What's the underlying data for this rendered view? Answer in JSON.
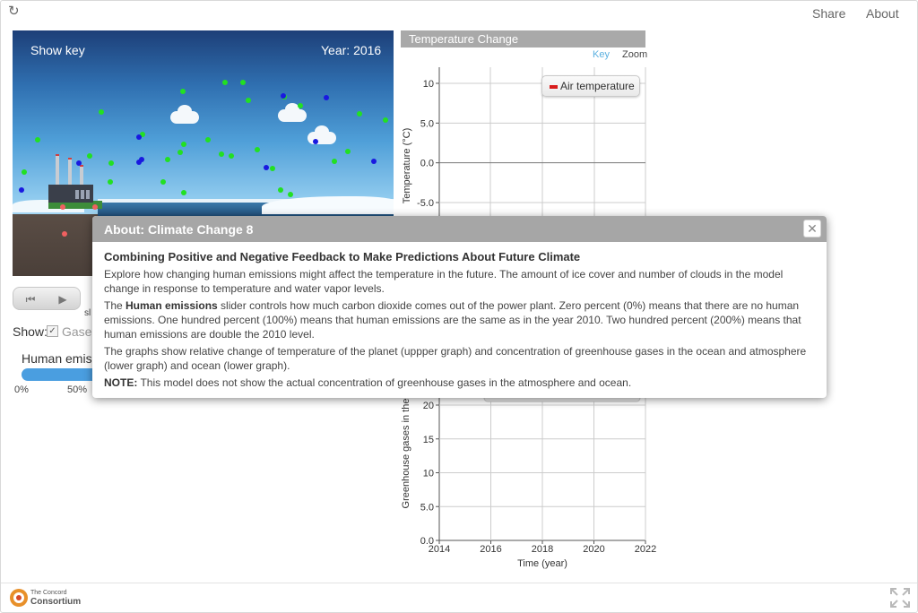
{
  "topbar": {
    "reload_icon": "reload-icon",
    "share": "Share",
    "about": "About"
  },
  "model": {
    "show_key": "Show key",
    "year": "Year: 2016"
  },
  "controls": {
    "slow_label": "sl",
    "show_label": "Show:",
    "gases_label": "Gases",
    "gases_checked": true,
    "emissions_label": "Human emiss",
    "slider_ticks": [
      "0%",
      "50%"
    ],
    "accent": "#4a9ee0"
  },
  "upper_graph": {
    "title": "Temperature Change",
    "key_link": "Key",
    "zoom_link": "Zoom",
    "legend": "Air temperature"
  },
  "lower_graph": {
    "xlabel": "Time (year)",
    "ylabel": "Greenhouse gases in the"
  },
  "chart_data": [
    {
      "type": "line",
      "title": "Temperature Change",
      "ylabel": "Temperature (°C)",
      "y_ticks": [
        "10",
        "5.0",
        "0.0",
        "-5.0"
      ],
      "y_tick_values": [
        10,
        5,
        0,
        -5
      ],
      "ylim": [
        -5,
        10
      ],
      "series": [
        {
          "name": "Air temperature",
          "color": "#d81b1b",
          "values": []
        }
      ],
      "grid": true,
      "legend": "top-right"
    },
    {
      "type": "line",
      "xlabel": "Time (year)",
      "ylabel": "Greenhouse gases in the",
      "x_ticks": [
        "2014",
        "2016",
        "2018",
        "2020",
        "2022"
      ],
      "x_tick_values": [
        2014,
        2016,
        2018,
        2020,
        2022
      ],
      "xlim": [
        2014,
        2022
      ],
      "y_ticks": [
        "20",
        "15",
        "10",
        "5.0",
        "0.0"
      ],
      "y_tick_values": [
        20,
        15,
        10,
        5,
        0
      ],
      "ylim": [
        0,
        20
      ],
      "grid": true
    }
  ],
  "dialog": {
    "title": "About: Climate Change 8",
    "close_icon": "close-icon",
    "heading": "Combining Positive and Negative Feedback to Make Predictions About Future Climate",
    "p1": "Explore how changing human emissions might affect the temperature in the future. The amount of ice cover and number of clouds in the model change in response to temperature and water vapor levels.",
    "p2_prefix": "The ",
    "p2_bold": "Human emissions",
    "p2_rest": " slider controls how much carbon dioxide comes out of the power plant. Zero percent (0%) means that there are no human emissions. One hundred percent (100%) means that human emissions are the same as in the year 2010. Two hundred percent (200%) means that human emissions are double the 2010 level.",
    "p3": "The graphs show relative change of temperature of the planet (uppper graph) and concentration of greenhouse gases in the ocean and atmosphere (lower graph) and ocean (lower graph).",
    "note_bold": "NOTE:",
    "note_rest": " This model does not show the actual concentration of greenhouse gases in the atmosphere and ocean."
  },
  "footer": {
    "logo_line1": "The Concord",
    "logo_line2": "Consortium",
    "fullscreen_icon": "fullscreen-icon"
  }
}
